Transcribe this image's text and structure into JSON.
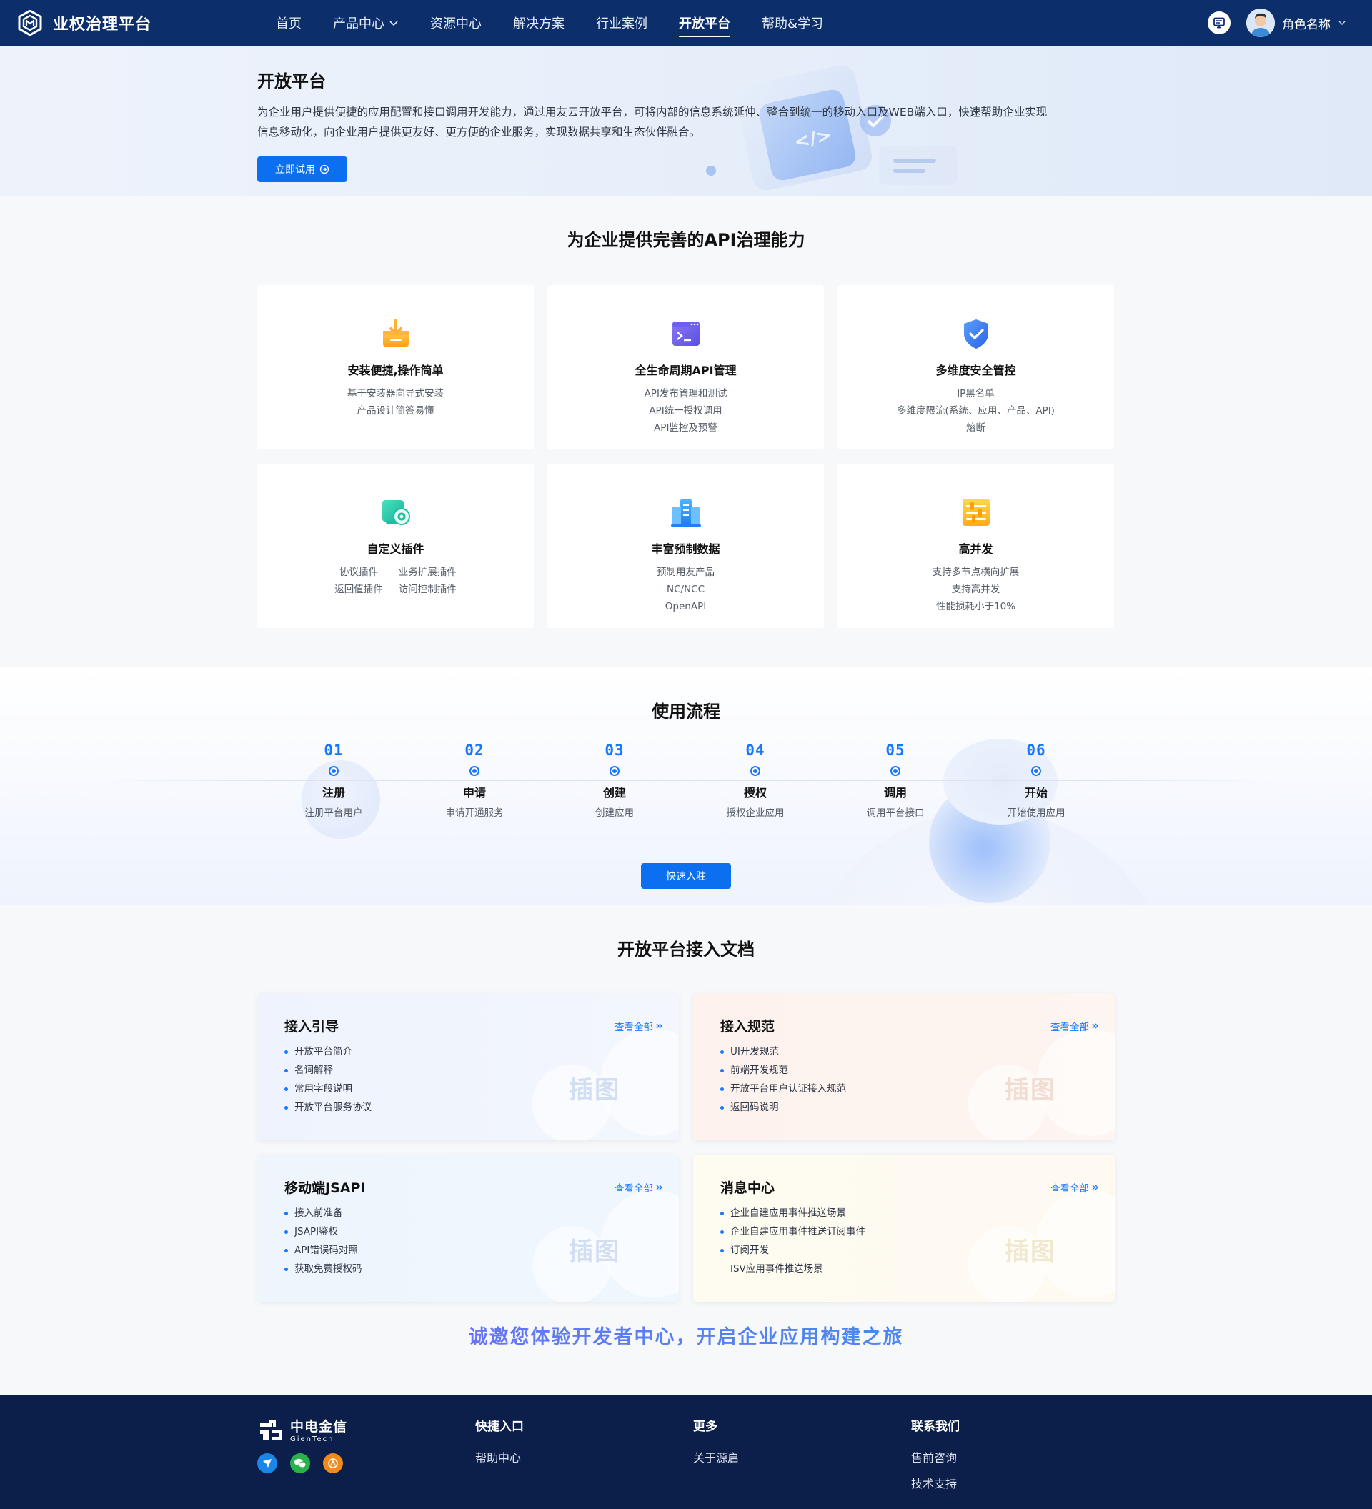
{
  "header": {
    "app_title": "业权治理平台",
    "nav": [
      {
        "label": "首页"
      },
      {
        "label": "产品中心"
      },
      {
        "label": "资源中心"
      },
      {
        "label": "解决方案"
      },
      {
        "label": "行业案例"
      },
      {
        "label": "开放平台"
      },
      {
        "label": "帮助&学习"
      }
    ],
    "user_name": "角色名称"
  },
  "hero": {
    "title": "开放平台",
    "description": "为企业用户提供便捷的应用配置和接口调用开发能力，通过用友云开放平台，可将内部的信息系统延伸、整合到统一的移动入口及WEB端入口，快速帮助企业实现信息移动化，向企业用户提供更友好、更方便的企业服务，实现数据共享和生态伙伴融合。",
    "button_label": "立即试用"
  },
  "capabilities": {
    "title": "为企业提供完善的API治理能力",
    "cards": [
      {
        "name": "安装便捷,操作简单",
        "lines": [
          "基于安装器向导式安装",
          "产品设计简答易懂"
        ]
      },
      {
        "name": "全生命周期API管理",
        "lines": [
          "API发布管理和测试",
          "API统一授权调用",
          "API监控及预警"
        ]
      },
      {
        "name": "多维度安全管控",
        "lines": [
          "IP黑名单",
          "多维度限流(系统、应用、产品、API)",
          "熔断"
        ]
      },
      {
        "name": "自定义插件",
        "lines": [
          "协议插件",
          "业务扩展插件",
          "返回值插件",
          "访问控制插件"
        ]
      },
      {
        "name": "丰富预制数据",
        "lines": [
          "预制用友产品",
          "NC/NCC",
          "OpenAPI"
        ]
      },
      {
        "name": "高并发",
        "lines": [
          "支持多节点横向扩展",
          "支持高并发",
          "性能损耗小于10%"
        ]
      }
    ]
  },
  "flow": {
    "title": "使用流程",
    "steps": [
      {
        "num": "01",
        "title": "注册",
        "sub": "注册平台用户"
      },
      {
        "num": "02",
        "title": "申请",
        "sub": "申请开通服务"
      },
      {
        "num": "03",
        "title": "创建",
        "sub": "创建应用"
      },
      {
        "num": "04",
        "title": "授权",
        "sub": "授权企业应用"
      },
      {
        "num": "05",
        "title": "调用",
        "sub": "调用平台接口"
      },
      {
        "num": "06",
        "title": "开始",
        "sub": "开始使用应用"
      }
    ],
    "button_label": "快速入驻"
  },
  "docs": {
    "title": "开放平台接入文档",
    "more_label": "查看全部",
    "illus_label": "插图",
    "cards": [
      {
        "title": "接入引导",
        "items": [
          "开放平台简介",
          "名词解释",
          "常用字段说明",
          "开放平台服务协议"
        ]
      },
      {
        "title": "接入规范",
        "items": [
          "UI开发规范",
          "前端开发规范",
          "开放平台用户认证接入规范",
          "返回码说明"
        ]
      },
      {
        "title": "移动端JSAPI",
        "items": [
          "接入前准备",
          "JSAPI鉴权",
          "API错误码对照",
          "获取免费授权码"
        ]
      },
      {
        "title": "消息中心",
        "items": [
          "企业自建应用事件推送场景",
          "企业自建应用事件推送订阅事件",
          "订阅开发",
          "ISV应用事件推送场景"
        ]
      }
    ],
    "slogan": "诚邀您体验开发者中心，开启企业应用构建之旅"
  },
  "footer": {
    "brand_cn": "中电金信",
    "brand_en": "GienTech",
    "columns": [
      {
        "title": "快捷入口",
        "links": [
          "帮助中心"
        ]
      },
      {
        "title": "更多",
        "links": [
          "关于源启"
        ]
      },
      {
        "title": "联系我们",
        "links": [
          "售前咨询",
          "技术支持"
        ]
      }
    ]
  },
  "colors": {
    "header_bg": "#0c2f6b",
    "primary": "#0b6ff0",
    "accent_blue": "#1677ff",
    "footer_bg": "#0c1f4a"
  },
  "icons": [
    "logo-icon",
    "chevron-down-icon",
    "monitor-icon",
    "avatar",
    "arrow-circle-right-icon",
    "install-box-icon",
    "terminal-icon",
    "shield-check-icon",
    "plugin-icon",
    "data-building-icon",
    "concurrency-icon",
    "double-chevron-right-icon",
    "bird-icon",
    "wechat-icon",
    "weibo-icon"
  ]
}
